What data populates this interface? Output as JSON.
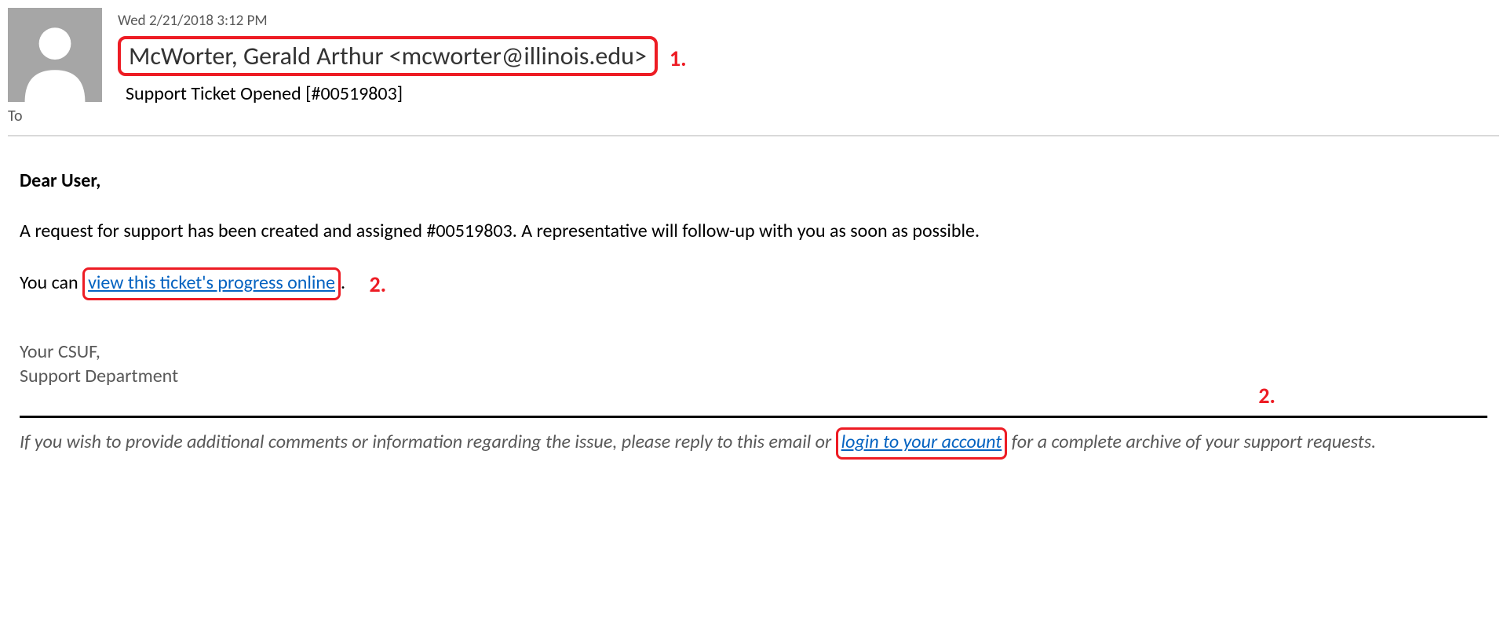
{
  "header": {
    "date": "Wed 2/21/2018 3:12 PM",
    "sender": "McWorter, Gerald Arthur <mcworter@illinois.edu>",
    "subject": "Support Ticket Opened [#00519803]",
    "to_label": "To"
  },
  "callouts": {
    "one": "1.",
    "two": "2.",
    "two_b": "2."
  },
  "body": {
    "greeting": "Dear User,",
    "para1": "A request for support has been created and assigned #00519803. A representative will follow-up with you as soon as possible.",
    "para2_pre": "You can ",
    "para2_link": "view this ticket's progress online",
    "para2_post": ".",
    "sign1": "Your CSUF,",
    "sign2": "Support Department"
  },
  "footer": {
    "pre": "If you wish to provide additional comments or information regarding the issue, please reply to this email or ",
    "link": "login to your account",
    "post": " for a complete archive of your support requests."
  }
}
